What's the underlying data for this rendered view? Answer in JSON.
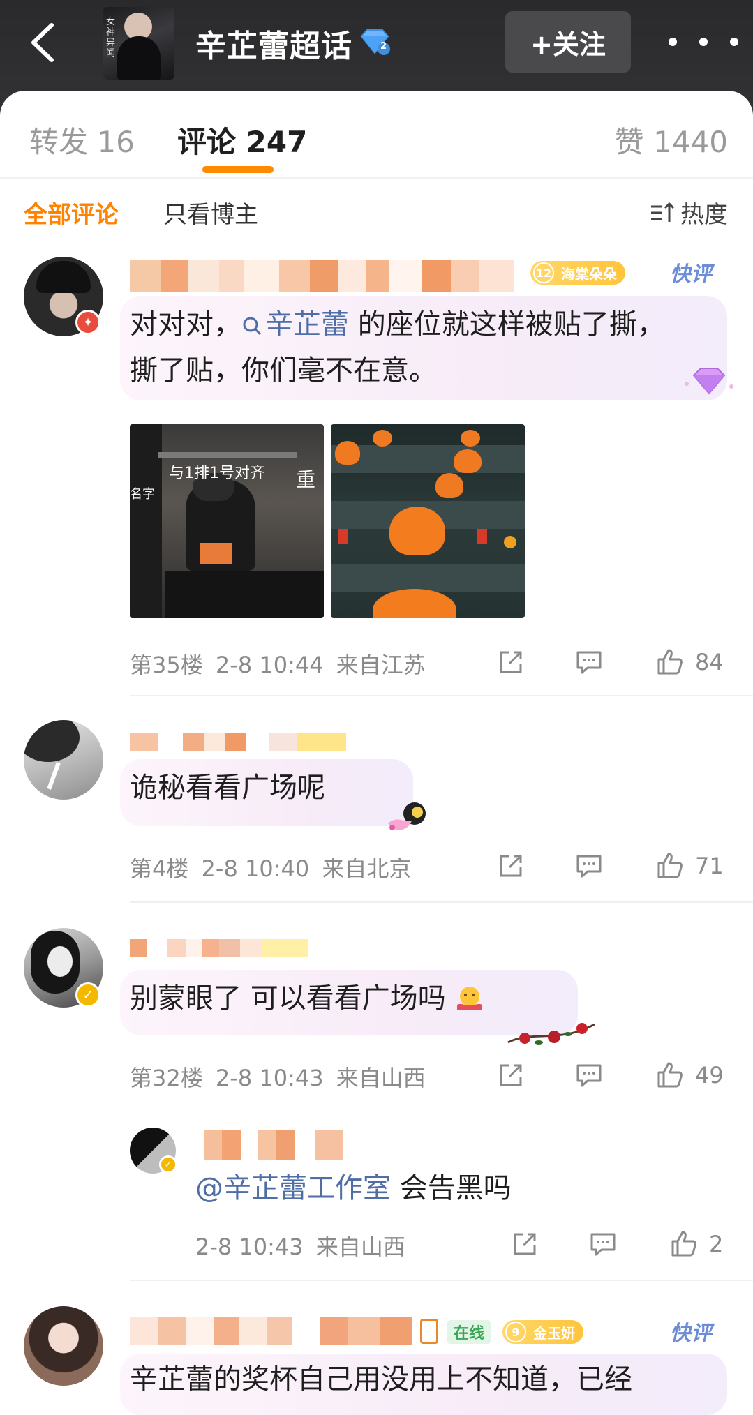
{
  "header": {
    "topic_title": "辛芷蕾超话",
    "topic_cover_text": "女神异闻",
    "diamond_level": "2",
    "follow_label": "+关注"
  },
  "tabs": [
    {
      "label": "转发 16"
    },
    {
      "label": "评论 247"
    },
    {
      "label": "赞 1440"
    }
  ],
  "filters": {
    "all": "全部评论",
    "author_only": "只看博主",
    "sort": "热度"
  },
  "comments": [
    {
      "level": "12",
      "badge": "海棠朵朵",
      "quick": "快评",
      "text_before": "对对对，",
      "topic_link": "辛芷蕾",
      "text_after": " 的座位就这样被贴了撕，",
      "text_line2": "撕了贴，你们毫不在意。",
      "photo1_caption": "与1排1号对齐",
      "photo1_caption2": "重",
      "photo1_side": "名字",
      "floor": "第35楼",
      "time": "2-8 10:44",
      "location": "来自江苏",
      "likes": "84"
    },
    {
      "text": "诡秘看看广场呢",
      "floor": "第4楼",
      "time": "2-8 10:40",
      "location": "来自北京",
      "likes": "71"
    },
    {
      "text": "别蒙眼了 可以看看广场吗",
      "floor": "第32楼",
      "time": "2-8 10:43",
      "location": "来自山西",
      "likes": "49",
      "reply": {
        "mention": "@辛芷蕾工作室",
        "text": " 会告黑吗",
        "time": "2-8 10:43",
        "location": "来自山西",
        "likes": "2"
      }
    },
    {
      "online": "在线",
      "level": "9",
      "badge": "金玉妍",
      "quick": "快评",
      "text": "辛芷蕾的奖杯自己用没用上不知道，已经"
    }
  ],
  "colors": {
    "accent": "#ff8200",
    "link": "#4f6ea5",
    "header_bg": "#2f2f32"
  }
}
